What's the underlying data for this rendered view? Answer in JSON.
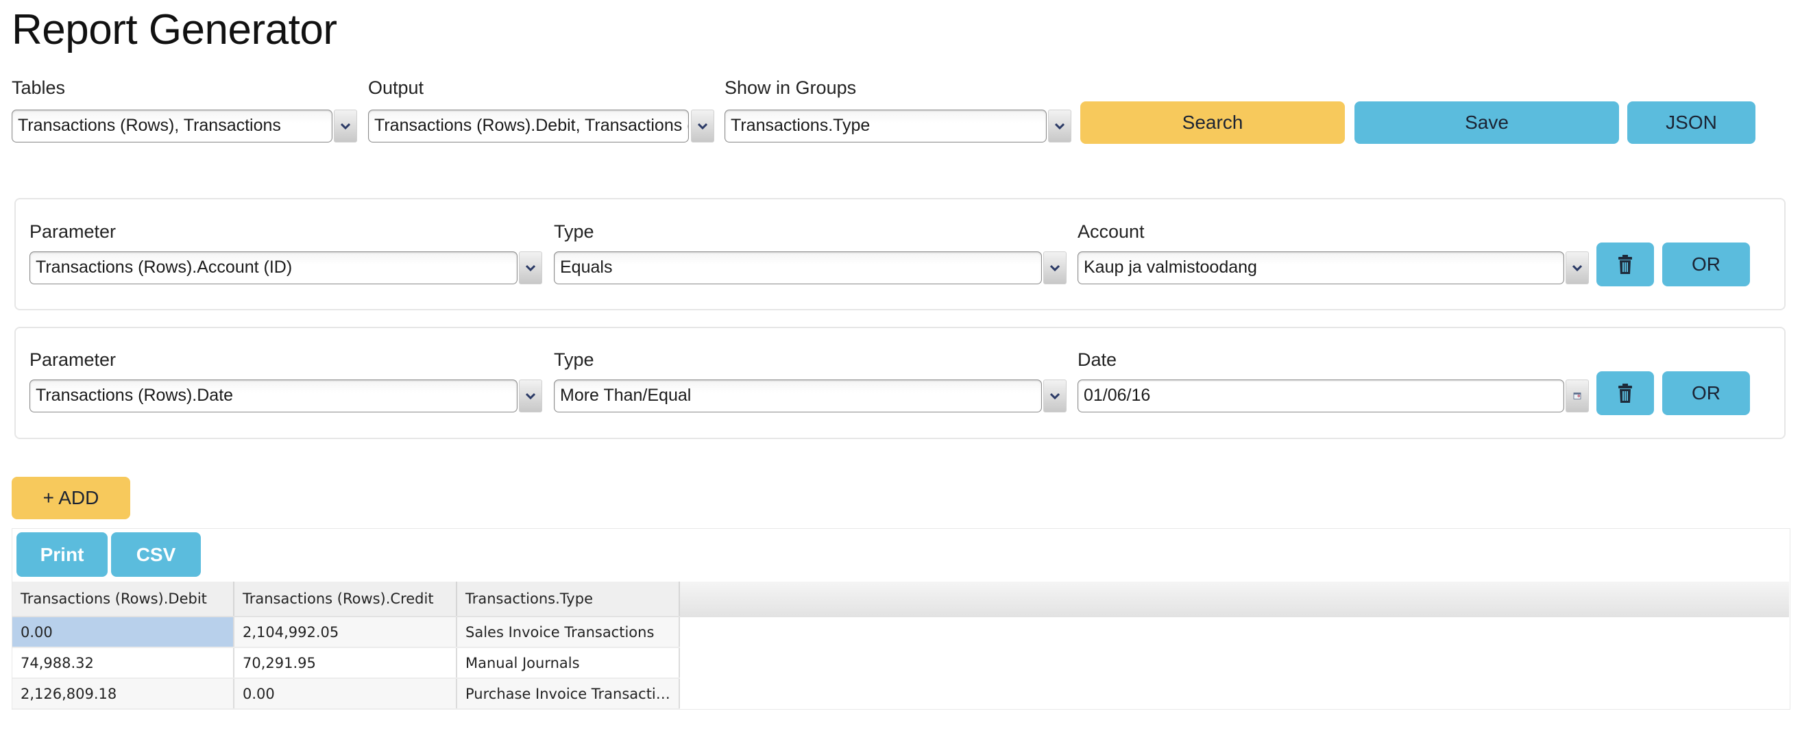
{
  "page": {
    "title": "Report Generator"
  },
  "top": {
    "tables": {
      "label": "Tables",
      "value": "Transactions (Rows), Transactions"
    },
    "output": {
      "label": "Output",
      "value": "Transactions (Rows).Debit, Transactions (Rows).Credit"
    },
    "groups": {
      "label": "Show in Groups",
      "value": "Transactions.Type"
    },
    "search_label": "Search",
    "save_label": "Save",
    "json_label": "JSON"
  },
  "filters": [
    {
      "parameter_label": "Parameter",
      "parameter_value": "Transactions (Rows).Account (ID)",
      "type_label": "Type",
      "type_value": "Equals",
      "value_label": "Account",
      "value_value": "Kaup ja valmistoodang",
      "delete_icon": "trash-icon",
      "or_label": "OR"
    },
    {
      "parameter_label": "Parameter",
      "parameter_value": "Transactions (Rows).Date",
      "type_label": "Type",
      "type_value": "More Than/Equal",
      "value_label": "Date",
      "value_value": "01/06/16",
      "delete_icon": "trash-icon",
      "or_label": "OR"
    }
  ],
  "add_label": "+ ADD",
  "results": {
    "print_label": "Print",
    "csv_label": "CSV",
    "columns": [
      "Transactions (Rows).Debit",
      "Transactions (Rows).Credit",
      "Transactions.Type"
    ],
    "rows": [
      [
        "0.00",
        "2,104,992.05",
        "Sales Invoice Transactions"
      ],
      [
        "74,988.32",
        "70,291.95",
        "Manual Journals"
      ],
      [
        "2,126,809.18",
        "0.00",
        "Purchase Invoice Transactions"
      ]
    ]
  },
  "colors": {
    "yellow": "#f7c95c",
    "blue": "#5bbcdd",
    "selected_row": "#b8d0eb"
  }
}
